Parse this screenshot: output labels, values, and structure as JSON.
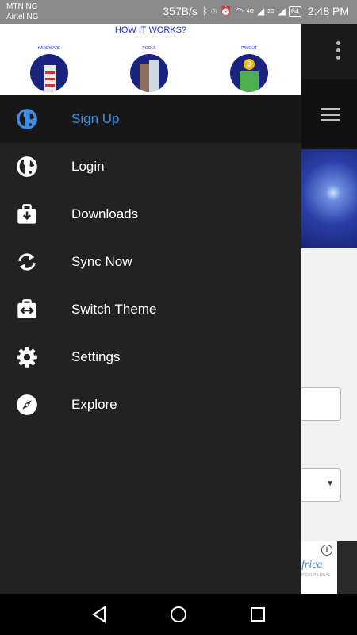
{
  "status_bar": {
    "carrier_1": "MTN NG",
    "carrier_2": "Airtel NG",
    "net_speed": "357B/s",
    "signal_4g": "4G",
    "signal_2g": "2G",
    "battery": "64",
    "time": "2:48 PM"
  },
  "banner": {
    "title": "HOW IT WORKS?",
    "steps": [
      {
        "label": "HARDWARE"
      },
      {
        "label": "POOLS"
      },
      {
        "label": "PAYOUT"
      }
    ]
  },
  "menu": {
    "items": [
      {
        "label": "Sign Up",
        "icon": "globe-icon",
        "active": true
      },
      {
        "label": "Login",
        "icon": "globe-icon",
        "active": false
      },
      {
        "label": "Downloads",
        "icon": "briefcase-download-icon",
        "active": false
      },
      {
        "label": "Sync Now",
        "icon": "sync-icon",
        "active": false
      },
      {
        "label": "Switch Theme",
        "icon": "switch-theme-icon",
        "active": false
      },
      {
        "label": "Settings",
        "icon": "gear-icon",
        "active": false
      },
      {
        "label": "Explore",
        "icon": "compass-icon",
        "active": false
      }
    ]
  },
  "background_ad": {
    "brand_fragment": "frica",
    "sub_fragment": "PICKUP LOCAL"
  },
  "colors": {
    "drawer_bg": "#222222",
    "active_row_bg": "#181818",
    "active_label": "#3f8ee6",
    "banner_title": "#1d2fd6"
  }
}
